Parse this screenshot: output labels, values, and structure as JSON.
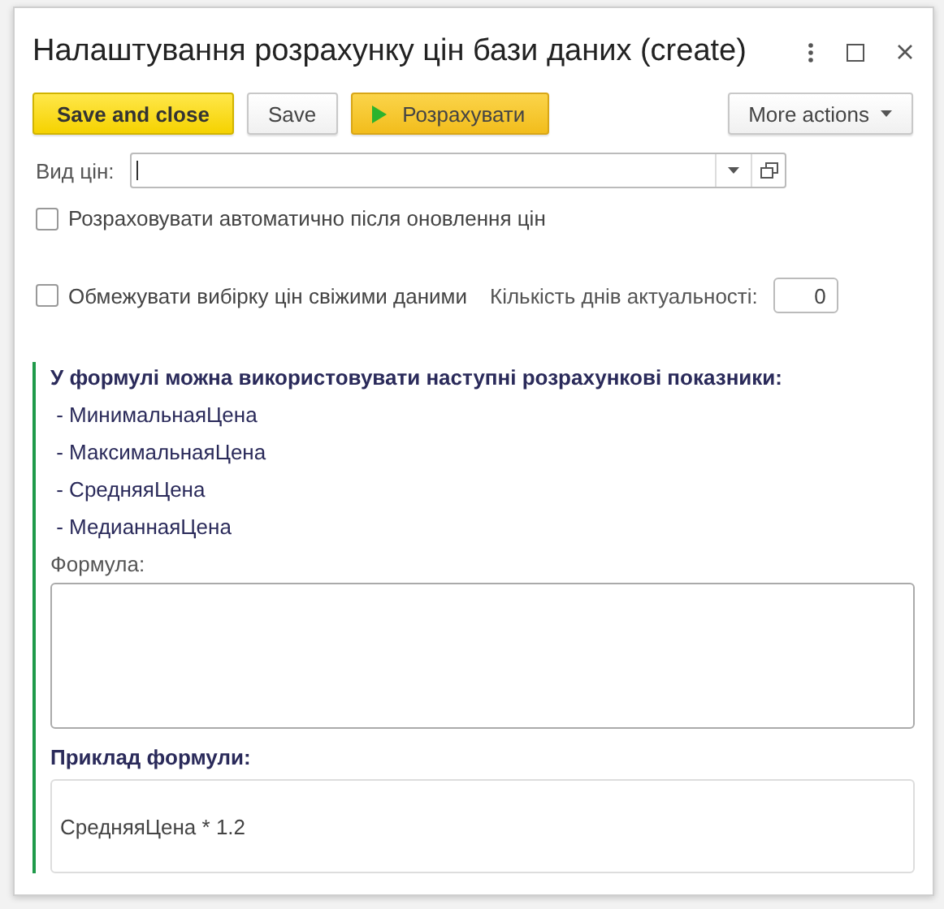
{
  "window": {
    "title": "Налаштування розрахунку цін бази даних (create)"
  },
  "toolbar": [
    {
      "kind": "primary",
      "label": "Save and close"
    },
    {
      "kind": "plain",
      "label": "Save"
    },
    {
      "kind": "run",
      "label": "Розрахувати"
    },
    {
      "kind": "menu",
      "label": "More actions"
    }
  ],
  "price_type": {
    "label": "Вид цін:"
  },
  "auto_recalc": {
    "label": "Розраховувати автоматично після оновлення цін",
    "checked": false
  },
  "limit_fresh": {
    "label": "Обмежувати вибірку цін свіжими даними",
    "checked": false
  },
  "days": {
    "label": "Кількість днів актуальності:",
    "value": "0"
  },
  "info": {
    "heading": "У формулі можна використовувати наступні розрахункові показники:",
    "items": [
      " - МинимальнаяЦена",
      " - МаксимальнаяЦена",
      " - СредняяЦена",
      " - МедианнаяЦена"
    ],
    "formula_label": "Формула:",
    "example_heading": "Приклад формули:",
    "example": "СредняяЦена * 1.2"
  }
}
